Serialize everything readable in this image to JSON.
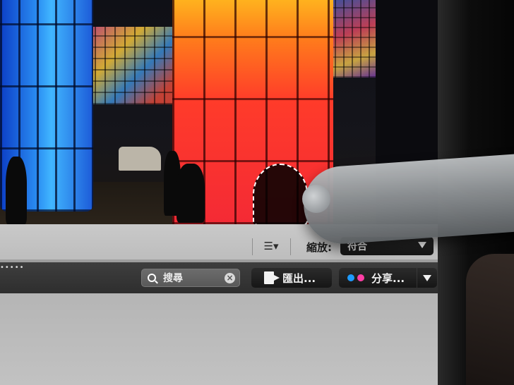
{
  "toolbar": {
    "zoom_label": "縮放:",
    "zoom_value": "符合",
    "view_icon": "list-view-icon"
  },
  "search": {
    "placeholder": "搜尋",
    "value": ""
  },
  "actions": {
    "export_label": "匯出...",
    "share_label": "分享...",
    "share_dot_colors": [
      "#1e9bff",
      "#ff3ea5"
    ]
  },
  "colors": {
    "toolbar_light": "#c4c4c4",
    "toolbar_dark": "#353535",
    "button_dark": "#1f1f1f"
  }
}
